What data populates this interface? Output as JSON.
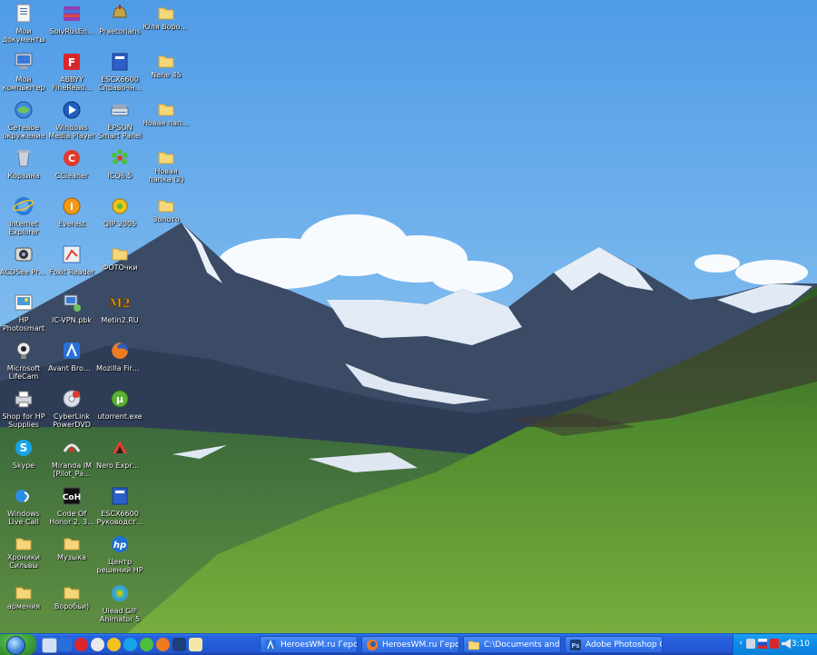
{
  "desktop": {
    "icons": [
      {
        "id": "my-documents",
        "label": "Мои документы",
        "icon": "my-documents-icon"
      },
      {
        "id": "my-computer",
        "label": "Мой компьютер",
        "icon": "my-computer-icon"
      },
      {
        "id": "network",
        "label": "Сетевое окружение",
        "icon": "network-icon"
      },
      {
        "id": "recycle-bin",
        "label": "Корзина",
        "icon": "recycle-bin-icon"
      },
      {
        "id": "internet-explorer",
        "label": "Internet Explorer",
        "icon": "internet-explorer-icon"
      },
      {
        "id": "acdsee",
        "label": "ACDSee Pro 2",
        "icon": "acdsee-icon"
      },
      {
        "id": "hp-photosmart",
        "label": "HP Photosmart Essential 2.5",
        "icon": "hp-photosmart-icon"
      },
      {
        "id": "lifecam",
        "label": "Microsoft LifeCam",
        "icon": "webcam-icon"
      },
      {
        "id": "shop-hp",
        "label": "Shop for HP Supplies",
        "icon": "printer-icon"
      },
      {
        "id": "skype",
        "label": "Skype",
        "icon": "skype-icon"
      },
      {
        "id": "windows-live-call",
        "label": "Windows Live Call",
        "icon": "windows-live-call-icon"
      },
      {
        "id": "hroniki",
        "label": "Хроники Сильвы",
        "icon": "folder-icon"
      },
      {
        "id": "armenia",
        "label": "армения",
        "icon": "folder-icon"
      },
      {
        "id": "solvusenter",
        "label": "SolvRusEn...",
        "icon": "archive-icon"
      },
      {
        "id": "abbyy",
        "label": "ABBYY FineRead...",
        "icon": "abbyy-icon"
      },
      {
        "id": "wmp",
        "label": "Windows Media Player",
        "icon": "media-player-icon"
      },
      {
        "id": "ccleaner",
        "label": "CCleaner",
        "icon": "ccleaner-icon"
      },
      {
        "id": "everest",
        "label": "Everest",
        "icon": "everest-icon"
      },
      {
        "id": "foxit",
        "label": "Foxit Reader",
        "icon": "pdf-reader-icon"
      },
      {
        "id": "ic-vpn",
        "label": "IC-VPN.pbk",
        "icon": "vpn-icon"
      },
      {
        "id": "avant",
        "label": "Avant Browser",
        "icon": "browser-icon"
      },
      {
        "id": "cyberlink",
        "label": "CyberLink PowerDVD",
        "icon": "dvd-icon"
      },
      {
        "id": "miranda",
        "label": "Miranda IM [Pilot_Pa...",
        "icon": "miranda-icon"
      },
      {
        "id": "cod",
        "label": "Code Of Honor 2. 3...",
        "icon": "game-icon"
      },
      {
        "id": "muzyka",
        "label": "Музыка",
        "icon": "folder-icon"
      },
      {
        "id": "vorobi",
        "label": "Воробьи)",
        "icon": "folder-icon"
      },
      {
        "id": "praetorians",
        "label": "Praetorians",
        "icon": "helmet-icon"
      },
      {
        "id": "escx-ref",
        "label": "ESCX6600 Справочн...",
        "icon": "manual-icon"
      },
      {
        "id": "epson-panel",
        "label": "EPSON Smart Panel",
        "icon": "scanner-icon"
      },
      {
        "id": "icq",
        "label": "ICQ6.5",
        "icon": "icq-icon"
      },
      {
        "id": "qip",
        "label": "QIP 2005",
        "icon": "qip-icon"
      },
      {
        "id": "fotochki",
        "label": "ФОТОчки",
        "icon": "folder-icon"
      },
      {
        "id": "metin2",
        "label": "Metin2.RU",
        "icon": "metin2-icon"
      },
      {
        "id": "firefox",
        "label": "Mozilla Firefox",
        "icon": "firefox-icon"
      },
      {
        "id": "utorrent",
        "label": "utorrent.exe",
        "icon": "utorrent-icon"
      },
      {
        "id": "nero",
        "label": "Nero Express",
        "icon": "nero-icon"
      },
      {
        "id": "escx-guide",
        "label": "ESCX6600 Руководст...",
        "icon": "manual-icon"
      },
      {
        "id": "hp-center",
        "label": "Центр решений HP",
        "icon": "hp-icon"
      },
      {
        "id": "ulead",
        "label": "Ulead GIF Animator 5",
        "icon": "gif-animator-icon"
      },
      {
        "id": "yulia",
        "label": "Юля Воронова",
        "icon": "folder-icon"
      },
      {
        "id": "nene45",
        "label": "Nene 45",
        "icon": "folder-icon"
      },
      {
        "id": "new-folder",
        "label": "Новая папка",
        "icon": "folder-icon"
      },
      {
        "id": "new-folder-2",
        "label": "Новая папка (2)",
        "icon": "folder-icon"
      },
      {
        "id": "zoloto",
        "label": "Золото",
        "icon": "folder-icon"
      }
    ]
  },
  "taskbar": {
    "quick_launch": [
      "show-desktop-icon",
      "avant-icon",
      "opera-icon",
      "messenger-icon",
      "qip-icon",
      "skype-icon",
      "icq-icon",
      "firefox-icon",
      "photoshop-icon",
      "file-icon"
    ],
    "tasks": [
      {
        "label": "HeroesWM.ru Геро...",
        "icon": "browser-icon"
      },
      {
        "label": "HeroesWM.ru Геро...",
        "icon": "firefox-icon"
      },
      {
        "label": "C:\\Documents and ...",
        "icon": "folder-icon"
      },
      {
        "label": "Adobe Photoshop C...",
        "icon": "photoshop-icon"
      }
    ],
    "clock": "3:10"
  },
  "colors": {
    "sky": "#5ea6e8",
    "taskbar": "#245edb",
    "tray": "#0d8ee8",
    "start": "#3a9b36"
  }
}
